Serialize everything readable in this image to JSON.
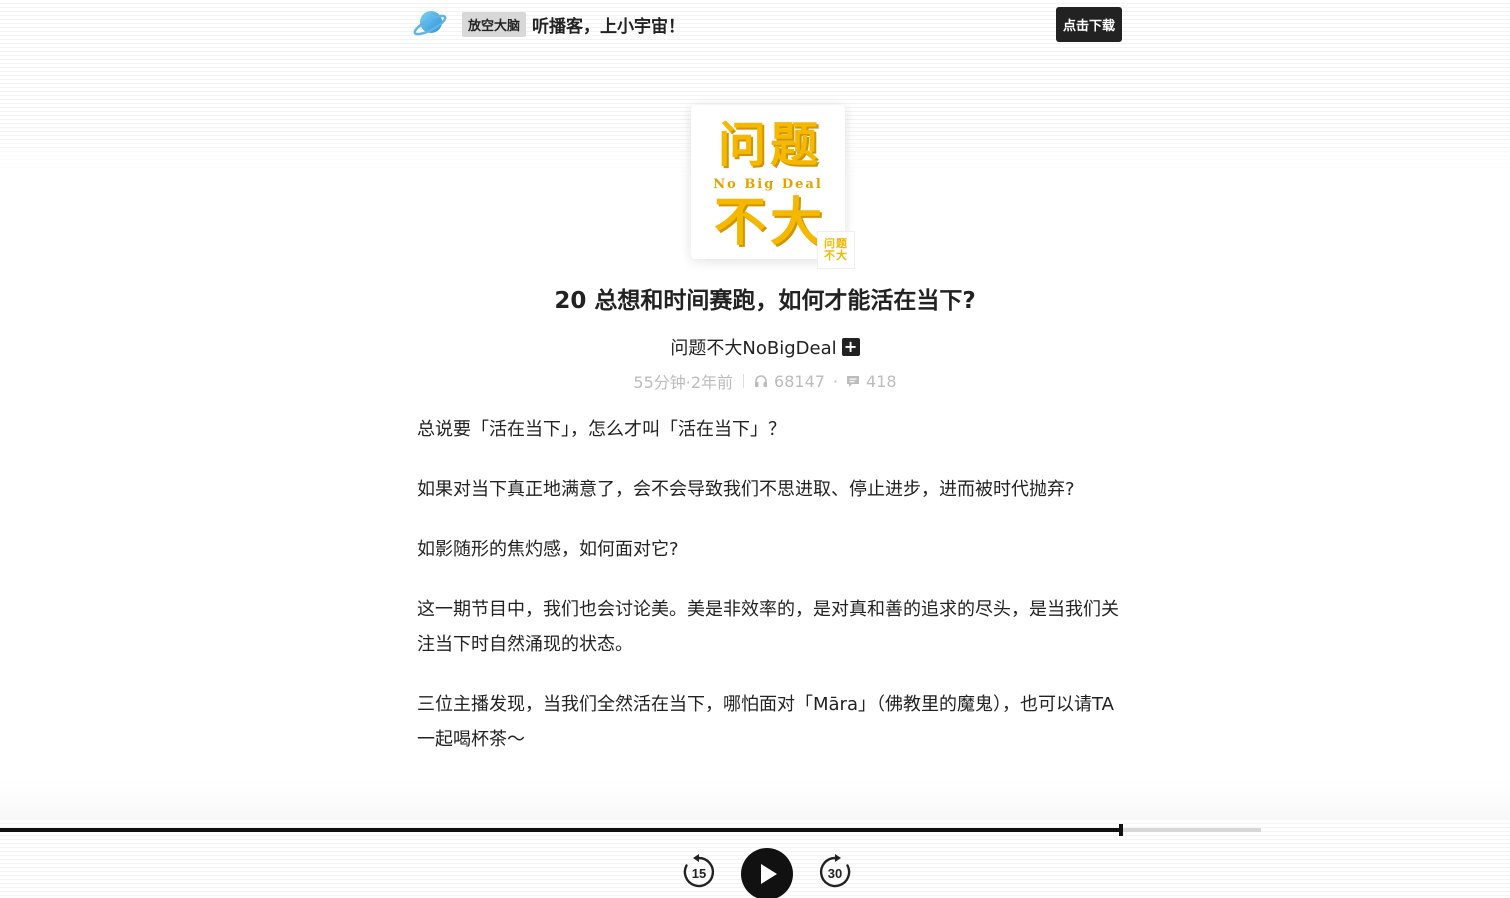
{
  "header": {
    "logo_icon": "planet-icon",
    "brand_badge": "放空大脑",
    "slogan": "听播客，上小宇宙！",
    "download_label": "点击下载"
  },
  "cover": {
    "title_top": "问题",
    "title_en": "No Big Deal",
    "title_bottom": "不大",
    "mini_top": "问题",
    "mini_bottom": "不大"
  },
  "episode": {
    "title": "20 总想和时间赛跑，如何才能活在当下?",
    "podcast_name": "问题不大NoBigDeal",
    "subscribe_icon": "plus-icon",
    "duration_age": "55分钟·2年前",
    "plays": "68147",
    "comments": "418",
    "meta_dot": "·"
  },
  "description": [
    "总说要「活在当下」，怎么才叫「活在当下」？",
    "如果对当下真正地满意了，会不会导致我们不思进取、停止进步，进而被时代抛弃?",
    "如影随形的焦灼感，如何面对它?",
    "这一期节目中，我们也会讨论美。美是非效率的，是对真和善的追求的尽头，是当我们关注当下时自然涌现的状态。",
    "三位主播发现，当我们全然活在当下，哪怕面对「Māra」（佛教里的魔鬼），也可以请TA一起喝杯茶～"
  ],
  "player": {
    "progress_fraction": 0.889,
    "rewind_label": "15",
    "forward_label": "30",
    "play_icon": "play-icon",
    "accent_color": "#222222",
    "cover_yellow": "#f5b800"
  }
}
